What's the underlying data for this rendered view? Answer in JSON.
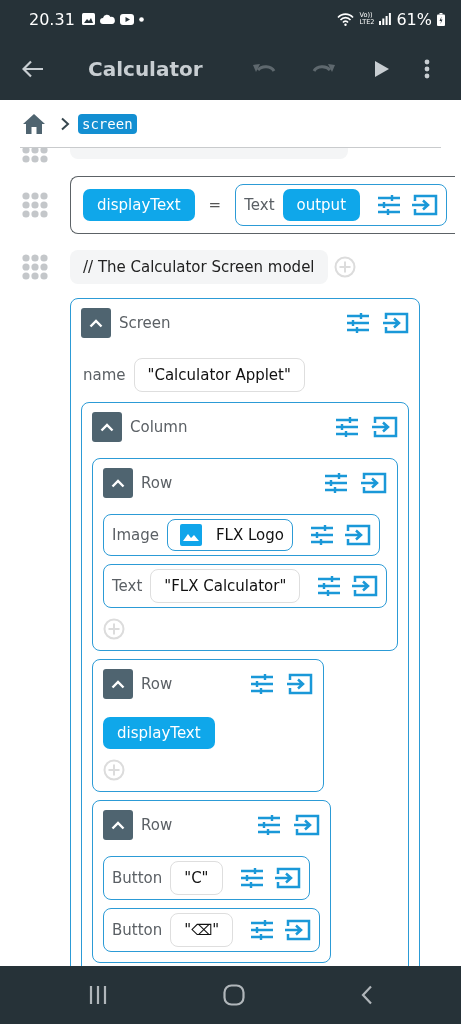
{
  "status_bar": {
    "time": "20.31",
    "network_top": "Vo))",
    "network_bottom": "LTE2",
    "battery": "61%"
  },
  "app_bar": {
    "title": "Calculator",
    "actions": [
      {
        "kind": "undo",
        "disabled": true
      },
      {
        "kind": "redo",
        "disabled": true
      },
      {
        "kind": "run",
        "disabled": false
      },
      {
        "kind": "more",
        "disabled": false
      }
    ]
  },
  "breadcrumb": [
    "screen"
  ],
  "statements": [
    {
      "kind": "clipped",
      "handle": true
    },
    {
      "kind": "assignment",
      "handle": true,
      "variable": "displayText",
      "operator": "=",
      "value": {
        "kind": "inline",
        "type": "Text",
        "arg": {
          "kind": "ref",
          "value": "output"
        }
      }
    },
    {
      "kind": "comment",
      "handle": true,
      "text": "// The Calculator Screen model"
    },
    {
      "kind": "widget",
      "widget": {
        "kind": "block",
        "type": "Screen",
        "expanded": true,
        "props": [
          {
            "label": "name",
            "value": "\"Calculator Applet\""
          }
        ],
        "children": [
          {
            "kind": "block",
            "type": "Column",
            "expanded": true,
            "children": [
              {
                "kind": "block",
                "type": "Row",
                "expanded": true,
                "add_button": true,
                "children": [
                  {
                    "kind": "inline",
                    "type": "Image",
                    "arg": {
                      "kind": "image",
                      "value": "FLX Logo"
                    }
                  },
                  {
                    "kind": "inline",
                    "type": "Text",
                    "arg": {
                      "kind": "string",
                      "value": "\"FLX Calculator\""
                    }
                  }
                ]
              },
              {
                "kind": "block",
                "type": "Row",
                "expanded": true,
                "add_button": true,
                "children": [
                  {
                    "kind": "ref",
                    "value": "displayText"
                  }
                ]
              },
              {
                "kind": "block",
                "type": "Row",
                "expanded": true,
                "children": [
                  {
                    "kind": "inline",
                    "type": "Button",
                    "arg": {
                      "kind": "string",
                      "value": "\"C\""
                    }
                  },
                  {
                    "kind": "inline",
                    "type": "Button",
                    "arg": {
                      "kind": "string",
                      "value": "\"⌫\""
                    }
                  }
                ]
              }
            ]
          }
        ]
      }
    }
  ]
}
